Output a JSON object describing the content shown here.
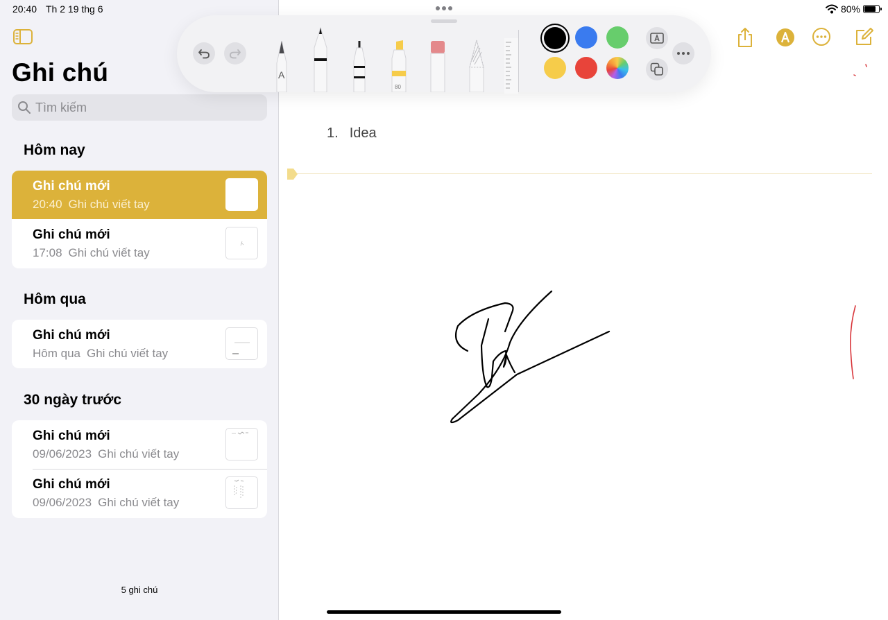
{
  "status": {
    "time": "20:40",
    "date": "Th 2 19 thg 6",
    "battery": "80%",
    "battery_level": 0.8
  },
  "sidebar": {
    "title": "Ghi chú",
    "search_placeholder": "Tìm kiếm",
    "sections": [
      {
        "title": "Hôm nay",
        "notes": [
          {
            "title": "Ghi chú mới",
            "time": "20:40",
            "subtitle": "Ghi chú viết tay",
            "selected": true
          },
          {
            "title": "Ghi chú mới",
            "time": "17:08",
            "subtitle": "Ghi chú viết tay",
            "selected": false
          }
        ]
      },
      {
        "title": "Hôm qua",
        "notes": [
          {
            "title": "Ghi chú mới",
            "time": "Hôm qua",
            "subtitle": "Ghi chú viết tay",
            "selected": false
          }
        ]
      },
      {
        "title": "30 ngày trước",
        "notes": [
          {
            "title": "Ghi chú mới",
            "time": "09/06/2023",
            "subtitle": "Ghi chú viết tay",
            "selected": false
          },
          {
            "title": "Ghi chú mới",
            "time": "09/06/2023",
            "subtitle": "Ghi chú viết tay",
            "selected": false
          }
        ]
      }
    ],
    "count": "5 ghi chú"
  },
  "toolbar": {
    "icons": [
      "sidebar-icon",
      "share-icon",
      "markup-icon",
      "more-icon",
      "compose-icon"
    ],
    "accent": "#dcb23a"
  },
  "palette": {
    "tools": [
      "text-pen",
      "pen",
      "fineliner",
      "marker",
      "eraser",
      "lasso",
      "ruler"
    ],
    "marker_label": "80",
    "text_pen_label": "A",
    "colors": [
      "#000000",
      "#3a7bef",
      "#67cd6c",
      "#f6cc4a",
      "#e8443a",
      "rainbow"
    ],
    "selected_color": "#000000"
  },
  "note": {
    "list_number": "1.",
    "list_text": "Idea"
  }
}
